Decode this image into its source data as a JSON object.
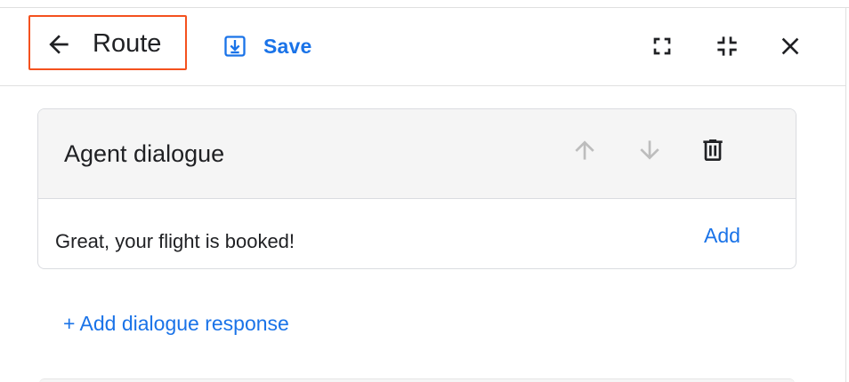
{
  "header": {
    "title": "Route",
    "save_label": "Save",
    "icons": {
      "back": "arrow-back-icon",
      "save": "save-download-icon",
      "fullscreen": "fullscreen-icon",
      "exit_fullscreen": "fullscreen-exit-icon",
      "close": "close-icon"
    },
    "highlight_color": "#f4511e"
  },
  "card": {
    "title": "Agent dialogue",
    "icons": {
      "move_up": "arrow-upward-icon",
      "move_down": "arrow-downward-icon",
      "delete": "trash-icon"
    },
    "response": "Great, your flight is booked!",
    "add_label": "Add"
  },
  "add_dialogue_label": "+ Add dialogue response",
  "colors": {
    "accent": "#1a73e8",
    "text": "#202124",
    "disabled_icon": "#bdbdbd",
    "card_header_bg": "#f5f5f5"
  }
}
